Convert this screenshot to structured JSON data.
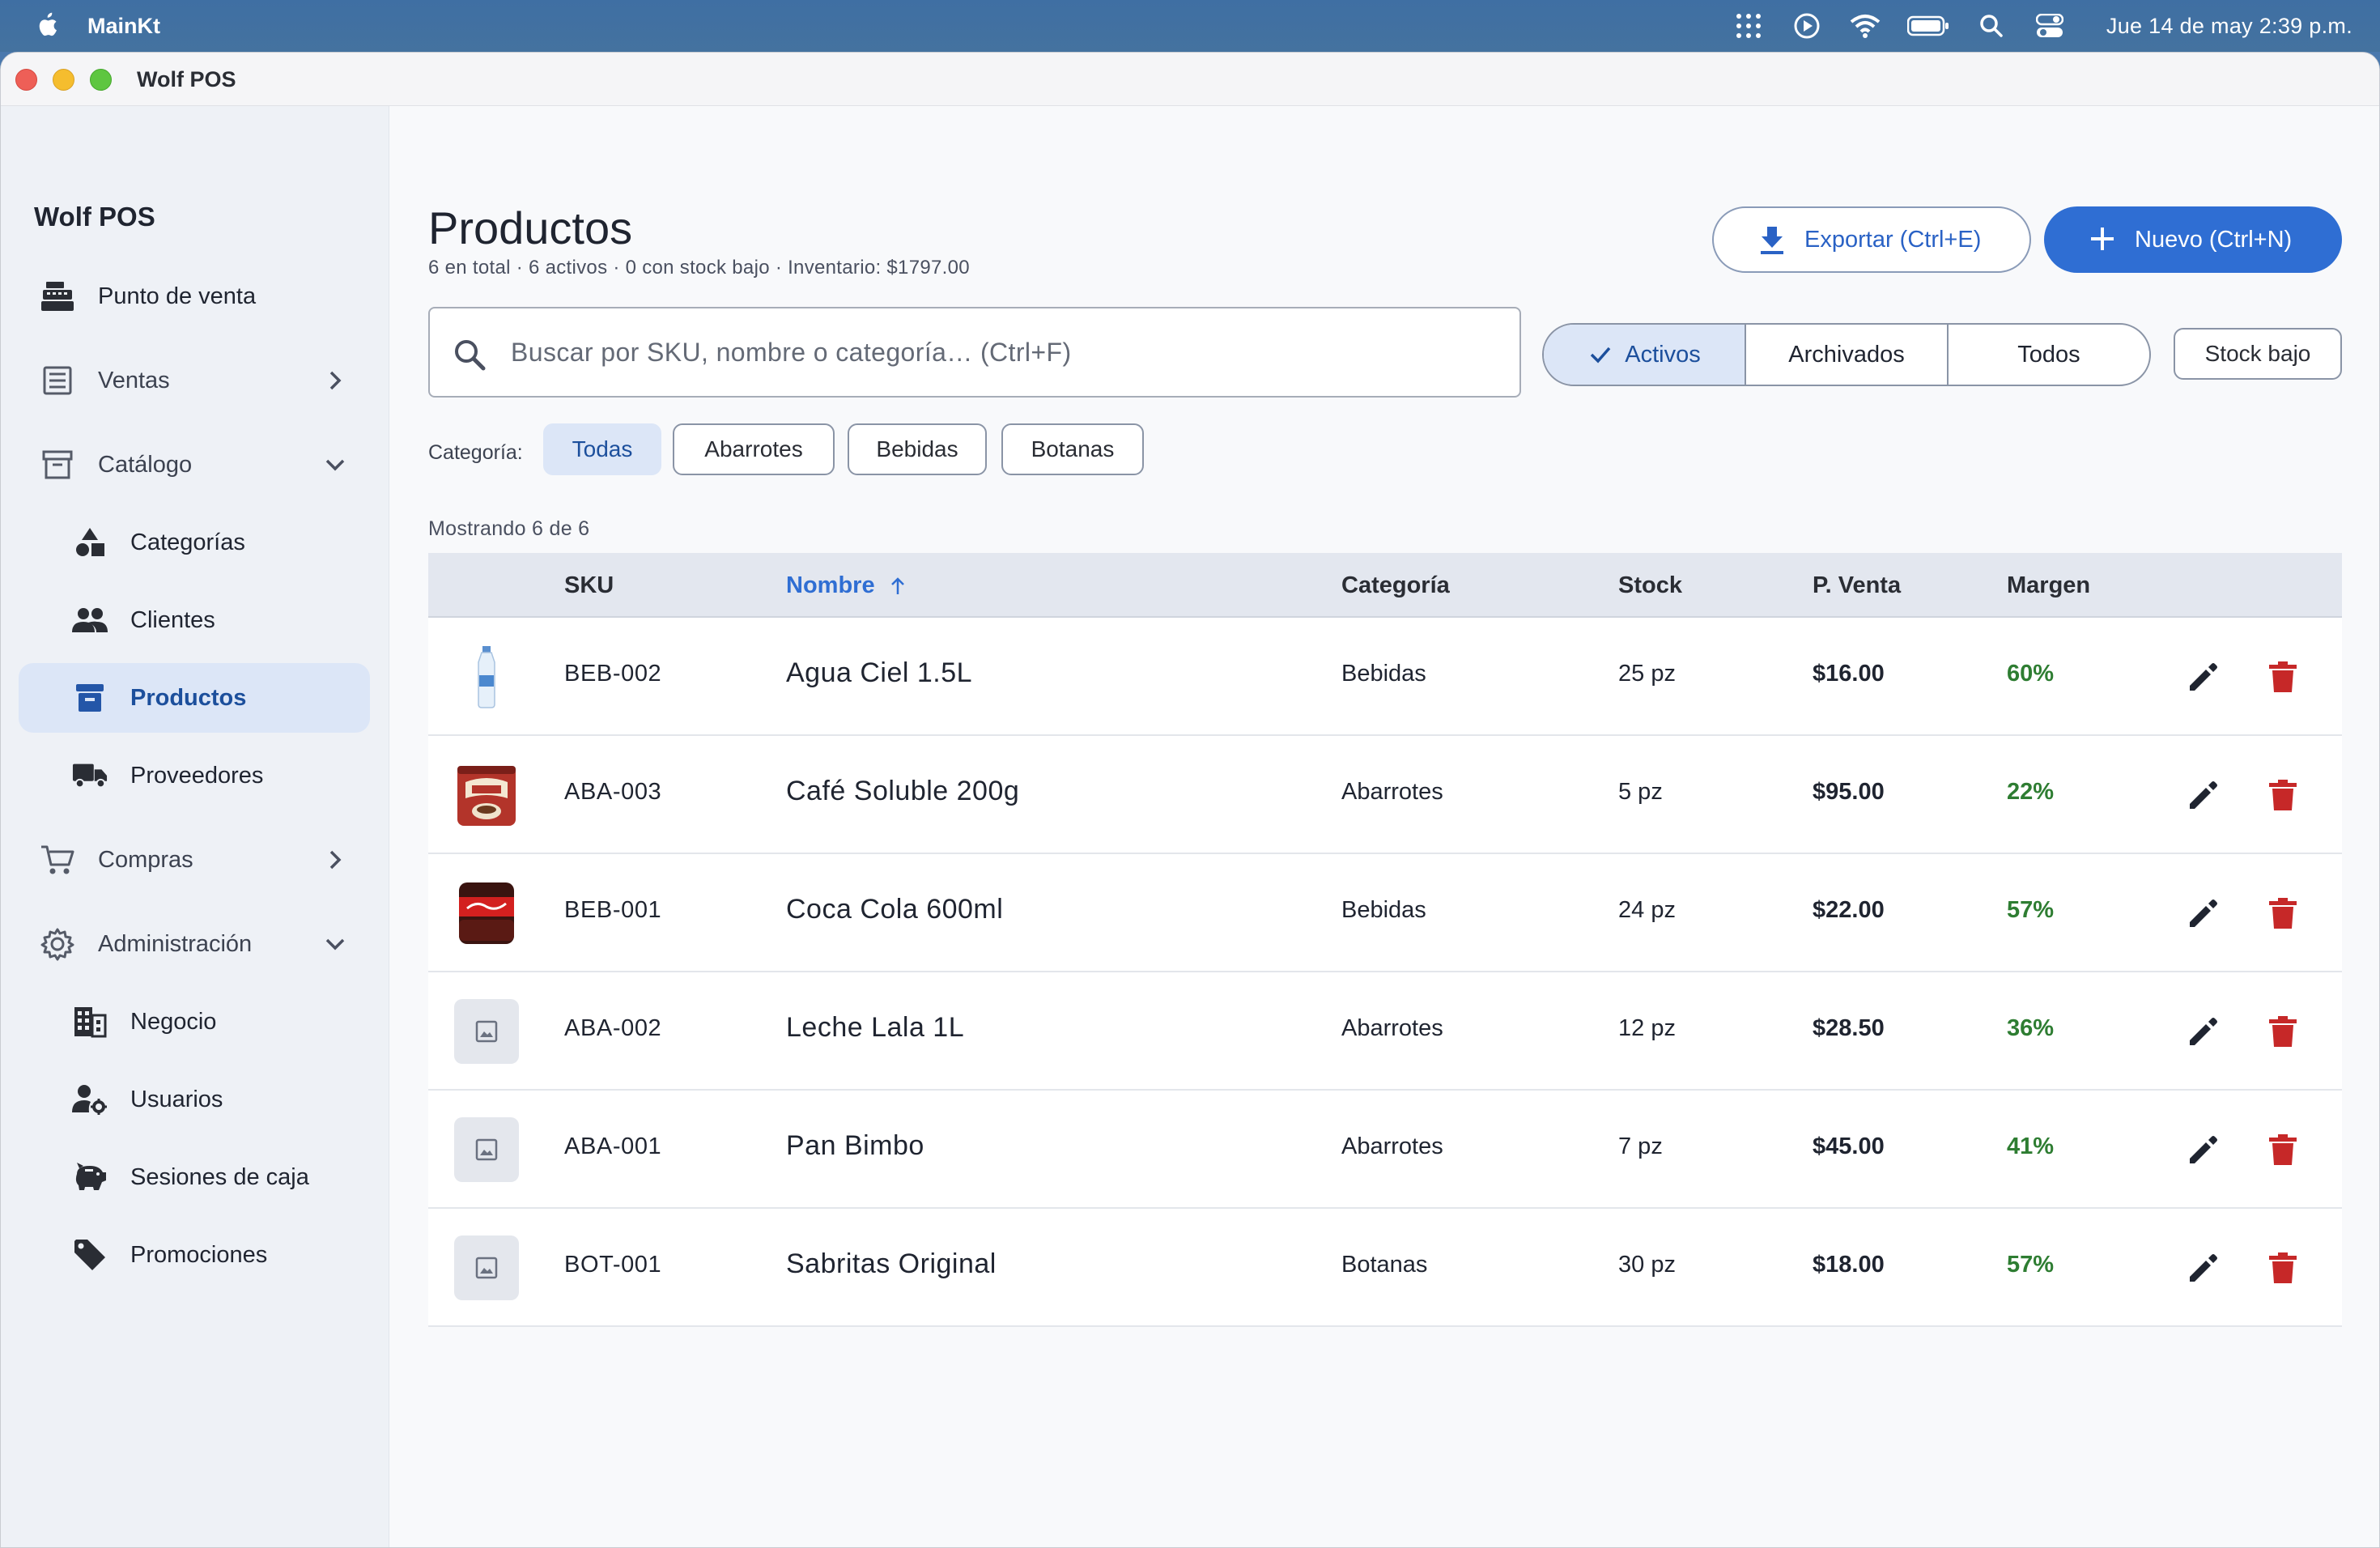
{
  "menubar": {
    "app_name": "MainKt",
    "clock": "Jue 14 de may  2:39 p.m."
  },
  "window": {
    "title": "Wolf POS"
  },
  "sidebar": {
    "brand": "Wolf POS",
    "items": [
      {
        "label": "Punto de venta",
        "icon": "cash-register-icon"
      },
      {
        "label": "Ventas",
        "icon": "receipt-list-icon"
      },
      {
        "label": "Catálogo",
        "icon": "archive-box-icon"
      },
      {
        "label": "Categorías",
        "icon": "shapes-icon"
      },
      {
        "label": "Clientes",
        "icon": "people-icon"
      },
      {
        "label": "Productos",
        "icon": "inventory-box-icon"
      },
      {
        "label": "Proveedores",
        "icon": "truck-icon"
      },
      {
        "label": "Compras",
        "icon": "cart-icon"
      },
      {
        "label": "Administración",
        "icon": "gear-icon"
      },
      {
        "label": "Negocio",
        "icon": "building-icon"
      },
      {
        "label": "Usuarios",
        "icon": "user-settings-icon"
      },
      {
        "label": "Sesiones de caja",
        "icon": "piggy-bank-icon"
      },
      {
        "label": "Promociones",
        "icon": "tag-icon"
      }
    ]
  },
  "header": {
    "title": "Productos",
    "subtitle": "6 en total · 6 activos · 0 con stock bajo · Inventario: $1797.00",
    "export_label": "Exportar (Ctrl+E)",
    "new_label": "Nuevo (Ctrl+N)"
  },
  "search": {
    "placeholder": "Buscar por SKU, nombre o categoría… (Ctrl+F)",
    "value": ""
  },
  "status_filter": {
    "options": [
      "Activos",
      "Archivados",
      "Todos"
    ],
    "selected": "Activos",
    "low_stock_label": "Stock bajo"
  },
  "category_filter": {
    "label": "Categoría:",
    "chips": [
      "Todas",
      "Abarrotes",
      "Bebidas",
      "Botanas"
    ],
    "selected": "Todas"
  },
  "showing": "Mostrando 6 de 6",
  "table": {
    "columns": [
      "SKU",
      "Nombre",
      "Categoría",
      "Stock",
      "P. Venta",
      "Margen"
    ],
    "sorted_by": "Nombre",
    "rows": [
      {
        "sku": "BEB-002",
        "name": "Agua Ciel 1.5L",
        "category": "Bebidas",
        "stock": "25 pz",
        "price": "$16.00",
        "margin": "60%",
        "image": "water-bottle"
      },
      {
        "sku": "ABA-003",
        "name": "Café Soluble 200g",
        "category": "Abarrotes",
        "stock": "5 pz",
        "price": "$95.00",
        "margin": "22%",
        "image": "coffee-can"
      },
      {
        "sku": "BEB-001",
        "name": "Coca Cola 600ml",
        "category": "Bebidas",
        "stock": "24 pz",
        "price": "$22.00",
        "margin": "57%",
        "image": "cola-bottle"
      },
      {
        "sku": "ABA-002",
        "name": "Leche Lala 1L",
        "category": "Abarrotes",
        "stock": "12 pz",
        "price": "$28.50",
        "margin": "36%",
        "image": "placeholder"
      },
      {
        "sku": "ABA-001",
        "name": "Pan Bimbo",
        "category": "Abarrotes",
        "stock": "7 pz",
        "price": "$45.00",
        "margin": "41%",
        "image": "placeholder"
      },
      {
        "sku": "BOT-001",
        "name": "Sabritas Original",
        "category": "Botanas",
        "stock": "30 pz",
        "price": "$18.00",
        "margin": "57%",
        "image": "placeholder"
      }
    ]
  },
  "colors": {
    "accent": "#2f6ed3",
    "active_bg": "#dce6f7",
    "margin_green": "#2e7d32",
    "delete_red": "#c62828"
  }
}
